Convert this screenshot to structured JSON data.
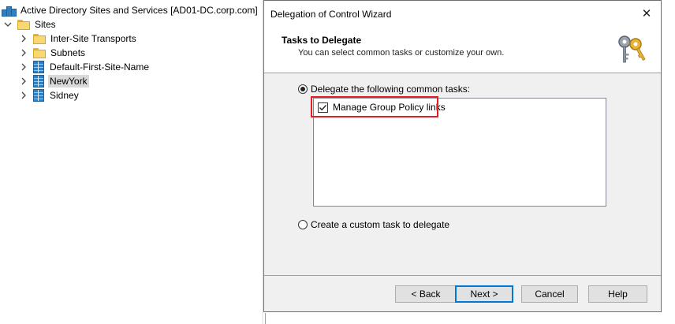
{
  "tree": {
    "root_label": "Active Directory Sites and Services [AD01-DC.corp.com]",
    "sites_label": "Sites",
    "children": [
      {
        "label": "Inter-Site Transports",
        "icon": "folder-icon"
      },
      {
        "label": "Subnets",
        "icon": "folder-icon"
      },
      {
        "label": "Default-First-Site-Name",
        "icon": "site-icon"
      },
      {
        "label": "NewYork",
        "icon": "site-icon",
        "selected": true
      },
      {
        "label": "Sidney",
        "icon": "site-icon"
      }
    ]
  },
  "wizard": {
    "title": "Delegation of Control Wizard",
    "close_glyph": "✕",
    "heading": "Tasks to Delegate",
    "subheading": "You can select common tasks or customize your own.",
    "option_common": "Delegate the following common tasks:",
    "option_common_selected": true,
    "tasks": [
      {
        "label": "Manage Group Policy links",
        "checked": true
      }
    ],
    "option_custom": "Create a custom task to delegate",
    "option_custom_selected": false,
    "buttons": {
      "back": "< Back",
      "next": "Next >",
      "cancel": "Cancel",
      "help": "Help"
    },
    "highlight_color": "#e01f26"
  }
}
